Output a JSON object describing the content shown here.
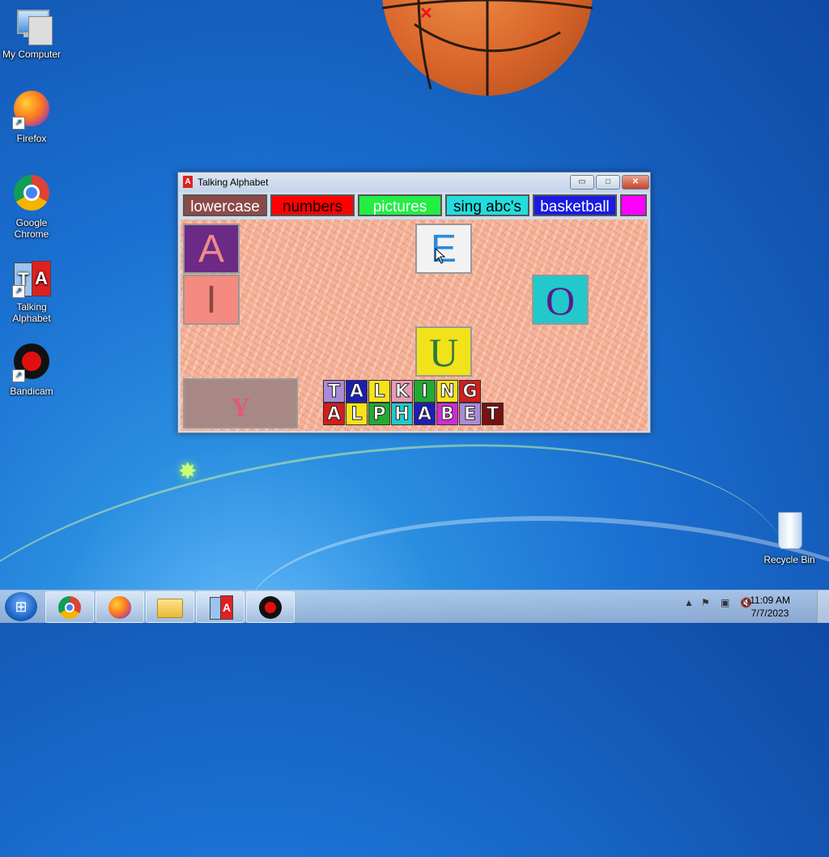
{
  "desktop": {
    "icons": [
      {
        "label": "My Computer",
        "icon": "computer-icon"
      },
      {
        "label": "Firefox",
        "icon": "firefox-icon"
      },
      {
        "label": "Google Chrome",
        "icon": "chrome-icon"
      },
      {
        "label": "Talking Alphabet",
        "icon": "talking-alphabet-icon"
      },
      {
        "label": "Bandicam",
        "icon": "bandicam-icon"
      },
      {
        "label": "Recycle Bin",
        "icon": "recycle-bin-icon"
      }
    ]
  },
  "floating_ball": {
    "icon": "basketball-icon",
    "close_glyph": "✕"
  },
  "window": {
    "title": "Talking Alphabet",
    "app_icon_glyph": "A",
    "controls": {
      "minimize": "▭",
      "maximize": "□",
      "close": "✕"
    },
    "menu": [
      {
        "label": "lowercase",
        "bg": "#8b4a48",
        "fg": "#ffffff"
      },
      {
        "label": "numbers",
        "bg": "#ff0000",
        "fg": "#000000"
      },
      {
        "label": "pictures",
        "bg": "#22ee44",
        "fg": "#ffffff"
      },
      {
        "label": "sing abc's",
        "bg": "#22dddd",
        "fg": "#000000"
      },
      {
        "label": "basketball",
        "bg": "#1a1ae0",
        "fg": "#ffffff"
      },
      {
        "label": "...",
        "bg": "#ff00ff",
        "fg": "#cc00cc"
      }
    ],
    "tiles": [
      {
        "letter": "A",
        "bg": "#6a2a86",
        "fg": "#f08a8a"
      },
      {
        "letter": "E",
        "bg": "#f2f2f2",
        "fg": "#2a8add"
      },
      {
        "letter": "I",
        "bg": "#f58a80",
        "fg": "#8a4a40"
      },
      {
        "letter": "O",
        "bg": "#22c8cc",
        "fg": "#5a1a88"
      },
      {
        "letter": "U",
        "bg": "#f2e21a",
        "fg": "#2a7a3a"
      },
      {
        "letter": "Y",
        "bg": "#a88884",
        "fg": "#e05a78"
      }
    ],
    "logo_row1": [
      "T",
      "A",
      "L",
      "K",
      "I",
      "N",
      "G"
    ],
    "logo_row2": [
      "A",
      "L",
      "P",
      "H",
      "A",
      "B",
      "E",
      "T"
    ],
    "logo_colors1": [
      "#a98bd8",
      "#1d1db8",
      "#f7e21a",
      "#e79bb0",
      "#22aa33",
      "#f7e21a",
      "#d21d1d"
    ],
    "logo_colors2": [
      "#d21d1d",
      "#f7e21a",
      "#22aa33",
      "#22c8cc",
      "#1d1db8",
      "#d12cd1",
      "#a98bd8",
      "#7a1010"
    ]
  },
  "taskbar": {
    "start_glyph": "⊞",
    "buttons": [
      {
        "name": "chrome",
        "icon": "chrome-icon"
      },
      {
        "name": "firefox",
        "icon": "firefox-icon"
      },
      {
        "name": "explorer",
        "icon": "folder-icon"
      },
      {
        "name": "talking-alphabet",
        "icon": "talking-alphabet-icon"
      },
      {
        "name": "bandicam",
        "icon": "bandicam-icon"
      }
    ],
    "time": "11:09 AM",
    "date": "7/7/2023"
  }
}
